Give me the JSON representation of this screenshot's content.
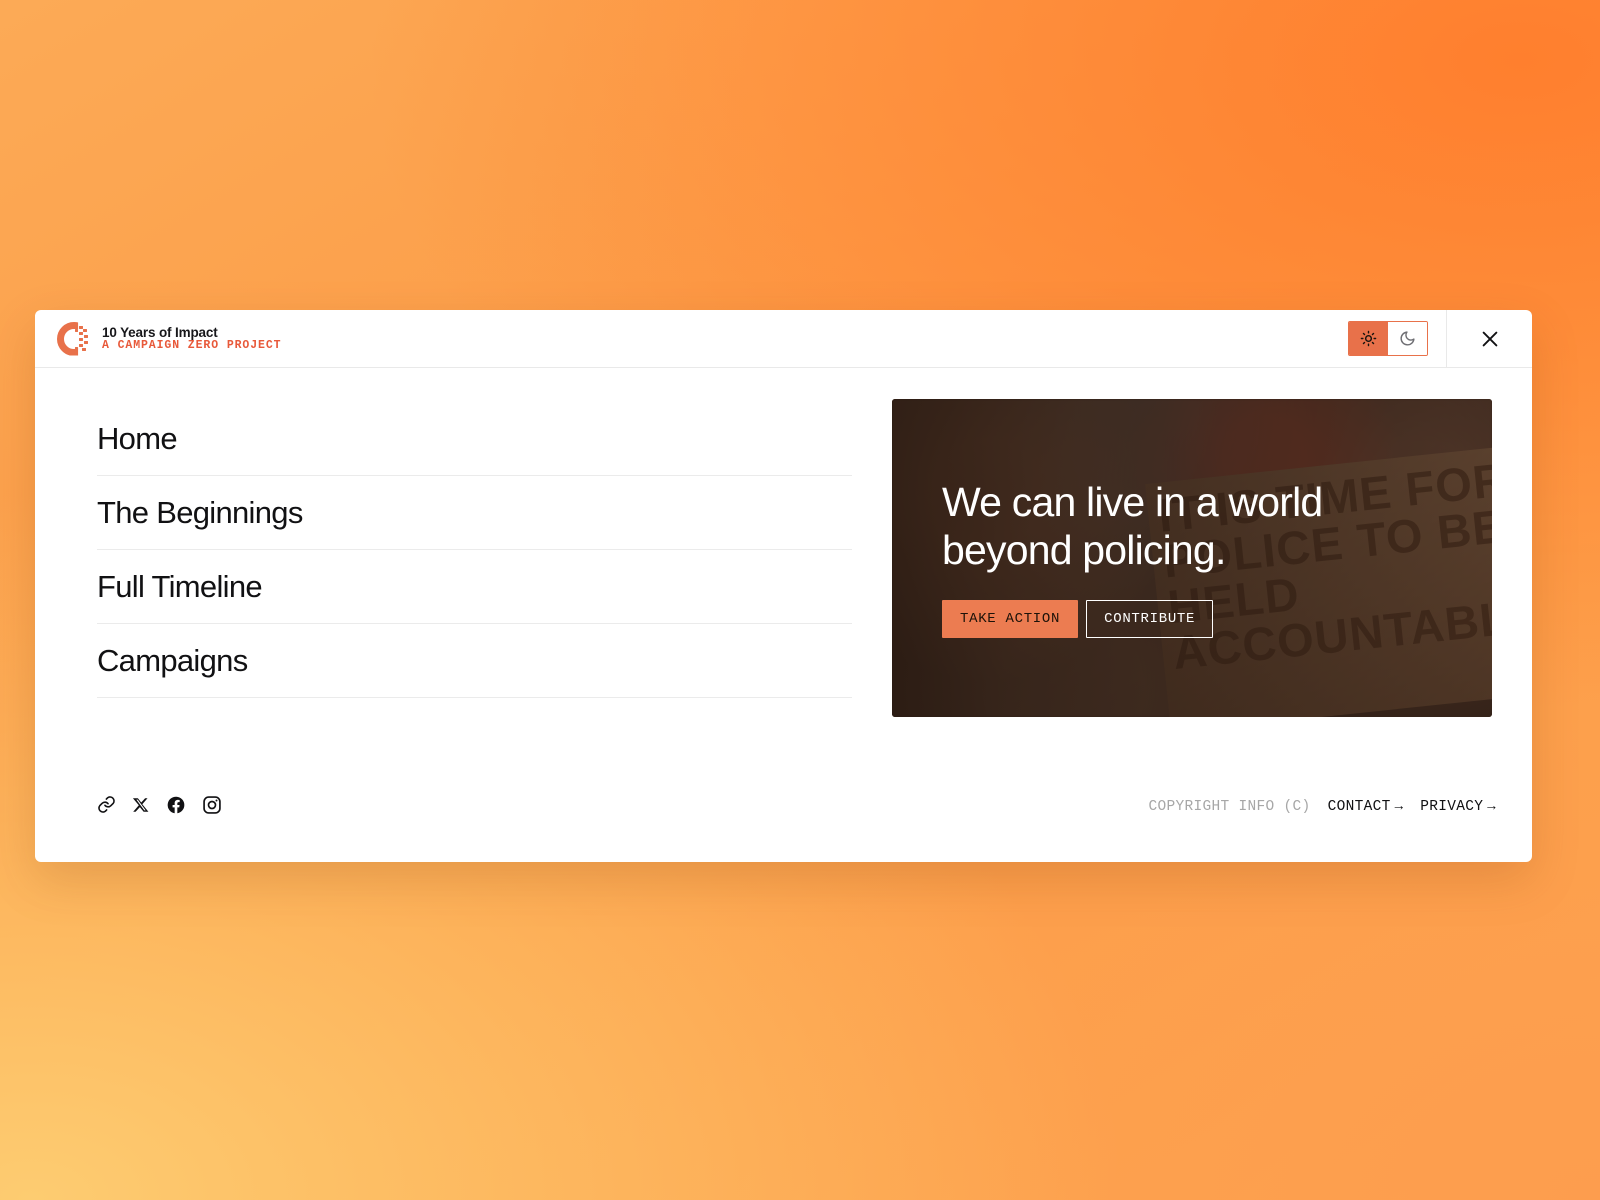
{
  "header": {
    "logo_icon": "campaign-zero-c-logo",
    "title": "10 Years of Impact",
    "subtitle": "A CAMPAIGN ZERO PROJECT",
    "theme_toggle": {
      "light_icon": "sun-icon",
      "dark_icon": "moon-icon",
      "active": "light"
    },
    "close_icon": "close-x-icon"
  },
  "nav": {
    "items": [
      {
        "label": "Home"
      },
      {
        "label": "The Beginnings"
      },
      {
        "label": "Full Timeline"
      },
      {
        "label": "Campaigns"
      }
    ]
  },
  "hero": {
    "title": "We can live in a world beyond policing.",
    "sign_text": "IT IS TIME FOR THE\nPOLICE TO BE\nHELD ACCOUNTABLE",
    "primary_button": "TAKE ACTION",
    "secondary_button": "CONTRIBUTE"
  },
  "footer": {
    "socials": [
      {
        "name": "link-icon",
        "label": "Website"
      },
      {
        "name": "x-twitter-icon",
        "label": "X"
      },
      {
        "name": "facebook-icon",
        "label": "Facebook"
      },
      {
        "name": "instagram-icon",
        "label": "Instagram"
      }
    ],
    "copyright": "COPYRIGHT INFO (C)",
    "contact": "CONTACT",
    "privacy": "PRIVACY",
    "arrow": "→"
  },
  "colors": {
    "accent": "#e8714a",
    "accent_button": "#ec7c51",
    "brand_sub": "#e8593a",
    "text": "#111113",
    "muted": "#a7a7a7"
  }
}
